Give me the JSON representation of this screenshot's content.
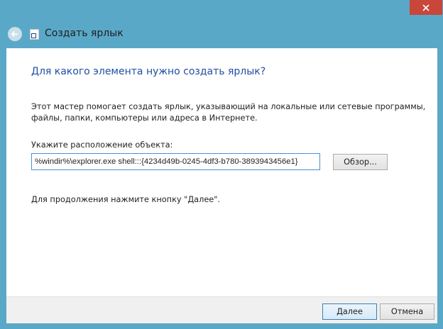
{
  "window": {
    "title": "Создать ярлык",
    "accent_color": "#5aa8c8",
    "close_button_color": "#c9463b",
    "close_icon": "close-icon",
    "back_icon": "back-arrow-icon",
    "title_icon": "shortcut-icon"
  },
  "main": {
    "heading": "Для какого элемента нужно создать ярлык?",
    "description": "Этот мастер помогает создать ярлык, указывающий на локальные или сетевые программы, файлы, папки, компьютеры или адреса в Интернете.",
    "location_label": "Укажите расположение объекта:",
    "location_value": "%windir%\\explorer.exe shell:::{4234d49b-0245-4df3-b780-3893943456e1}",
    "browse_label": "Обзор...",
    "continue_hint": "Для продолжения нажмите кнопку \"Далее\"."
  },
  "footer": {
    "next_label": "Далее",
    "cancel_label": "Отмена"
  }
}
